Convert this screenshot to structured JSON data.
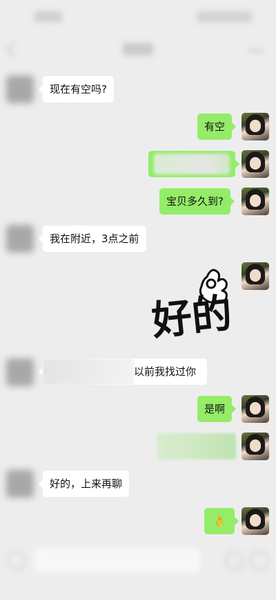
{
  "messages": [
    {
      "side": "left",
      "text": "现在有空吗?"
    },
    {
      "side": "right",
      "text": "有空"
    },
    {
      "side": "right",
      "text": "",
      "redacted": true
    },
    {
      "side": "right",
      "text": "宝贝多久到?"
    },
    {
      "side": "left",
      "text": "我在附近，3点之前"
    },
    {
      "side": "right",
      "sticker": "ok-hand-sticker",
      "text": "好的"
    },
    {
      "side": "left",
      "text": "以前我找过你",
      "partially_redacted": true
    },
    {
      "side": "right",
      "text": "是啊"
    },
    {
      "side": "right",
      "text": "",
      "redacted": true
    },
    {
      "side": "left",
      "text": "好的，上来再聊"
    },
    {
      "side": "right",
      "emoji": "👌"
    }
  ],
  "colors": {
    "background": "#ededed",
    "bubble_self": "#95ec69",
    "bubble_other": "#ffffff"
  }
}
